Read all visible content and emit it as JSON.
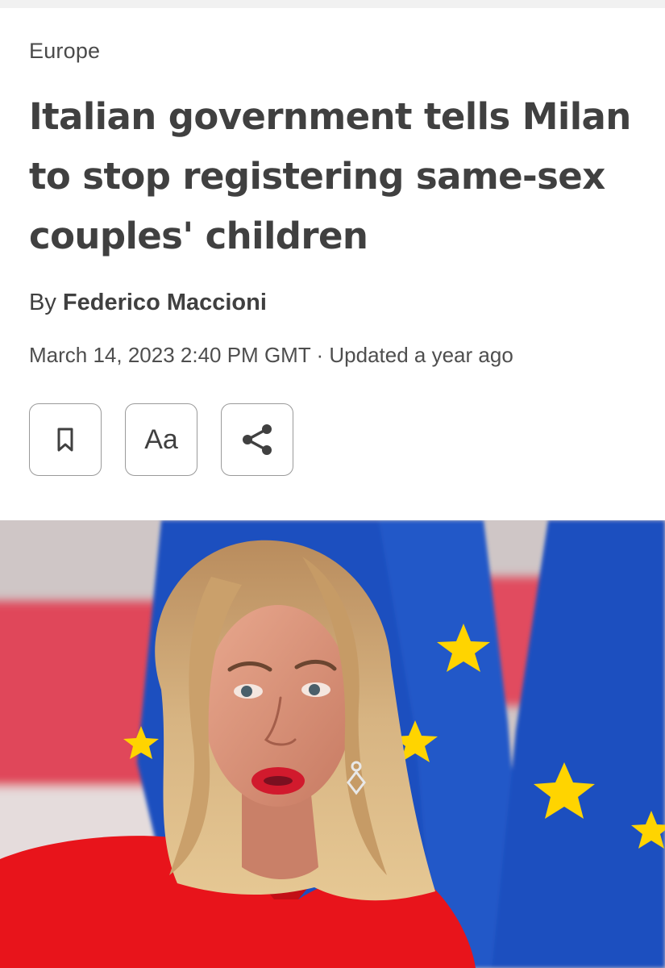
{
  "article": {
    "section": "Europe",
    "headline": "Italian government tells Milan to stop registering same-sex couples' children",
    "byline_prefix": "By",
    "author": "Federico Maccioni",
    "date": "March 14, 2023 2:40 PM GMT",
    "separator": "·",
    "updated": "Updated a year ago"
  },
  "actions": {
    "bookmark_icon": "bookmark-icon",
    "text_size_label": "Aa",
    "share_icon": "share-icon"
  },
  "hero_image": {
    "subject": "photo-woman-with-eu-flags"
  },
  "colors": {
    "text": "#404040",
    "eu_blue": "#1f4fbf",
    "eu_star": "#ffd400",
    "jacket_red": "#e8141b"
  }
}
